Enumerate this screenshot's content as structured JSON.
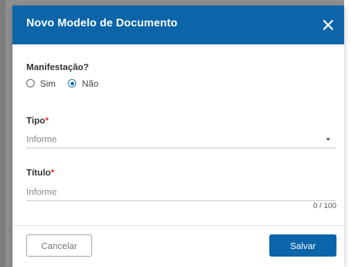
{
  "dialog": {
    "title": "Novo Modelo de Documento",
    "close_icon": "close-icon"
  },
  "manifestacao": {
    "label": "Manifestação?",
    "options": [
      {
        "label": "Sim",
        "checked": false
      },
      {
        "label": "Não",
        "checked": true
      }
    ]
  },
  "tipo": {
    "label": "Tipo",
    "required_mark": "*",
    "placeholder": "Informe",
    "arrow_icon": "caret-down-icon"
  },
  "titulo": {
    "label": "Título",
    "required_mark": "*",
    "placeholder": "Informe",
    "counter": "0 / 100"
  },
  "footer": {
    "cancel_label": "Cancelar",
    "save_label": "Salvar"
  },
  "colors": {
    "primary": "#0b65a8",
    "required": "#e0322e"
  }
}
